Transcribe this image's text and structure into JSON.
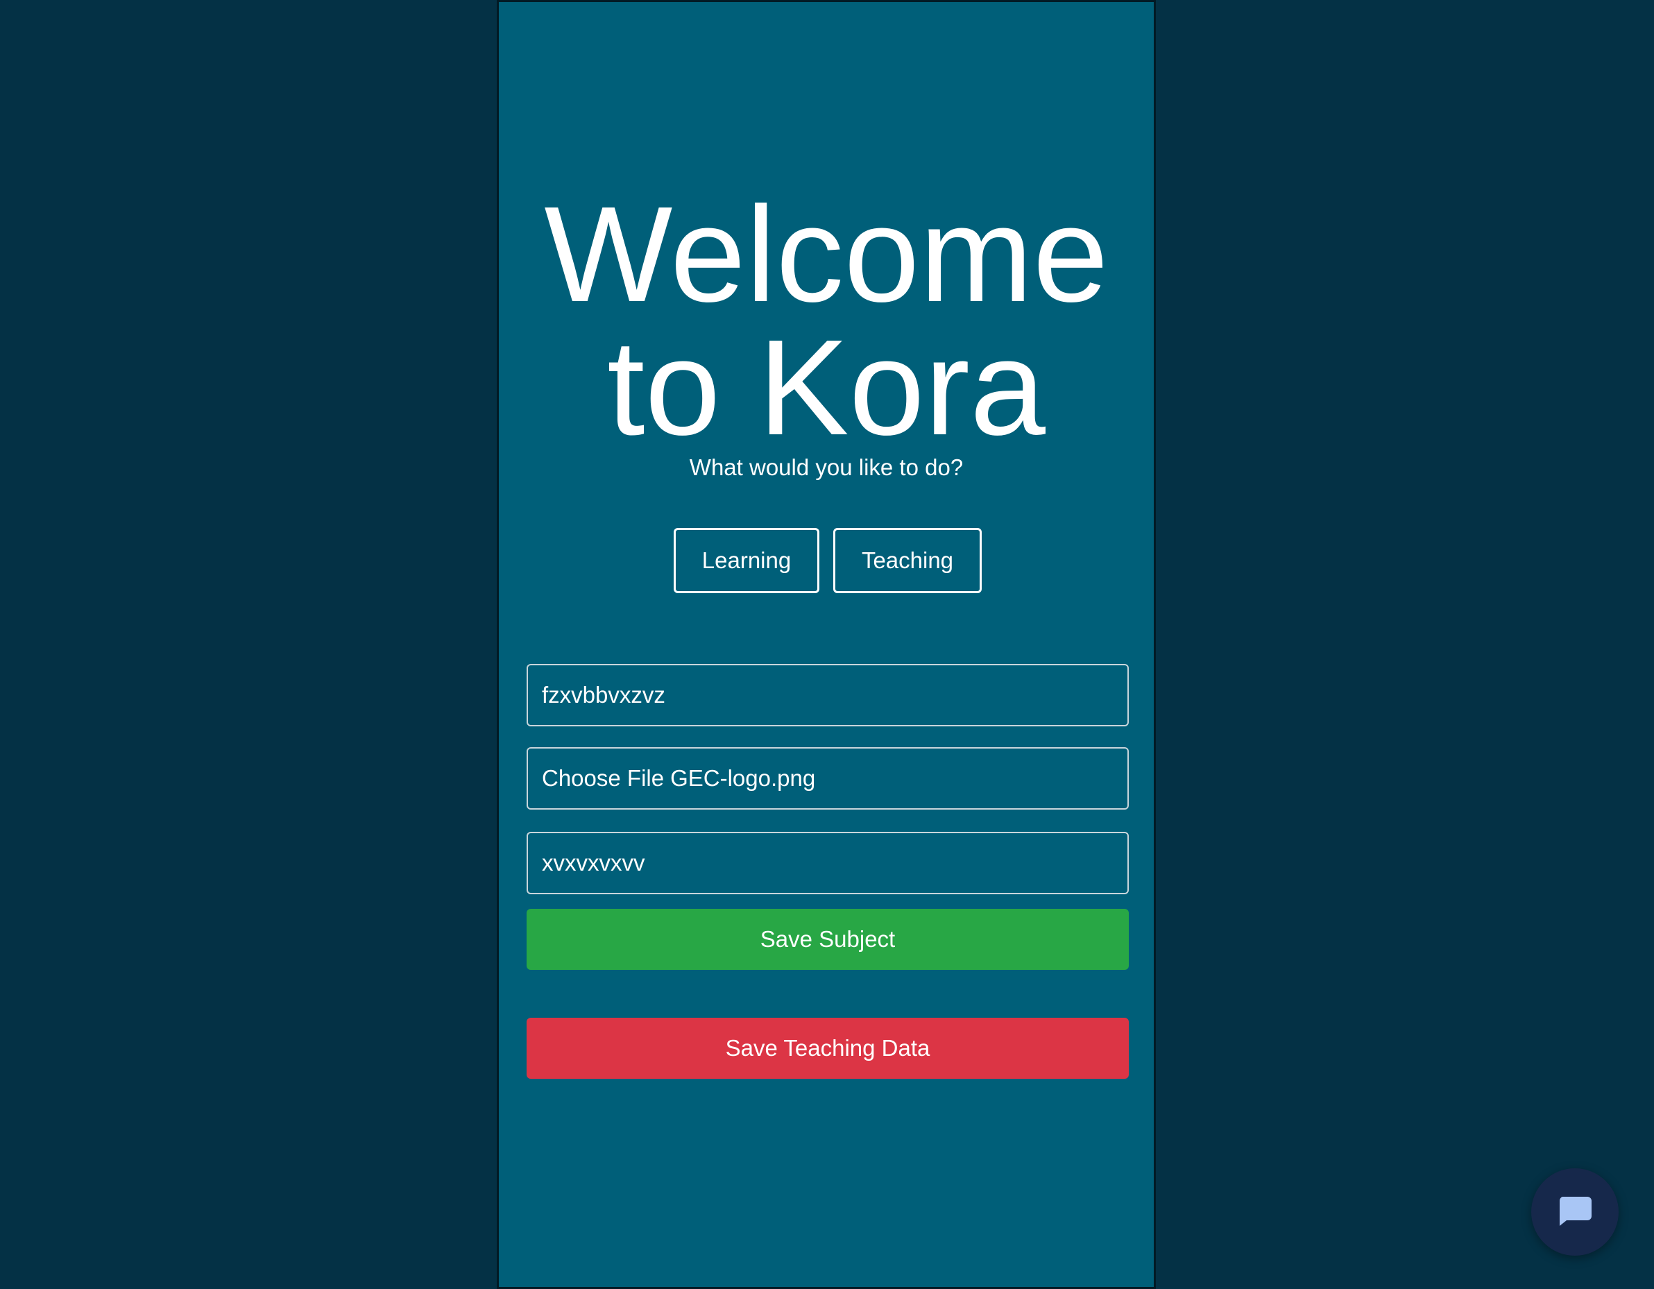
{
  "header": {
    "title_line1": "Welcome",
    "title_line2": "to Kora",
    "subtitle": "What would you like to do?"
  },
  "mode_buttons": {
    "learning_label": "Learning",
    "teaching_label": "Teaching"
  },
  "form": {
    "subject_value": "fzxvbbvxzvz",
    "file_button_label": "Choose File",
    "file_name": "GEC-logo.png",
    "description_value": "xvxvxvxvv",
    "save_subject_label": "Save Subject",
    "save_teaching_label": "Save Teaching Data"
  },
  "chat": {
    "icon": "chat-bubble-icon"
  },
  "colors": {
    "page_bg": "#043145",
    "panel_bg": "#005f79",
    "save_subject": "#28a745",
    "save_teaching": "#dc3545",
    "chat_fab": "#16284b",
    "chat_icon": "#a9c6f5"
  }
}
